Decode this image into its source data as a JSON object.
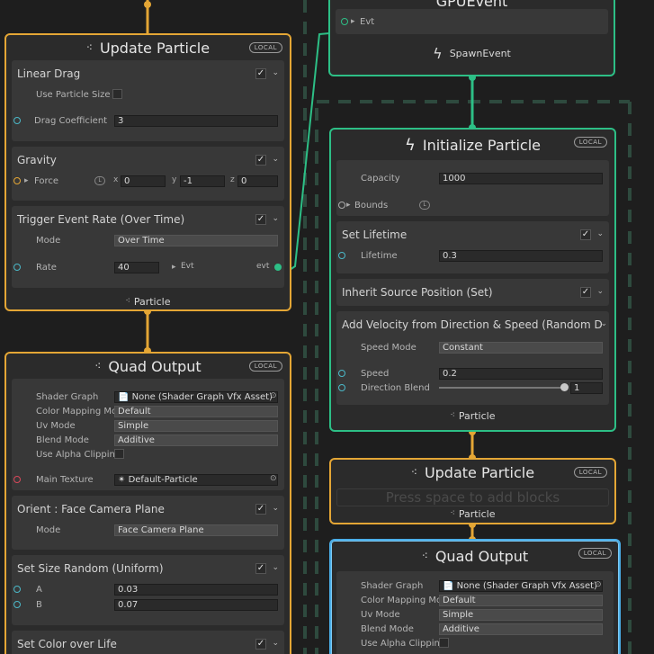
{
  "left": {
    "update": {
      "title": "Update Particle",
      "badge": "LOCAL",
      "linear_drag": {
        "title": "Linear Drag",
        "use_particle_size_label": "Use Particle Size",
        "drag_coefficient_label": "Drag Coefficient",
        "drag_coefficient_value": "3"
      },
      "gravity": {
        "title": "Gravity",
        "force_label": "Force",
        "x_label": "x",
        "x_value": "0",
        "y_label": "y",
        "y_value": "-1",
        "z_label": "z",
        "z_value": "0",
        "space_icon": "L"
      },
      "trigger": {
        "title": "Trigger Event Rate (Over Time)",
        "mode_label": "Mode",
        "mode_value": "Over Time",
        "rate_label": "Rate",
        "rate_value": "40",
        "evt_label": "Evt",
        "evt_out_label": "evt"
      },
      "footer": "Particle"
    },
    "quad": {
      "title": "Quad Output",
      "badge": "LOCAL",
      "shader_graph_label": "Shader Graph",
      "shader_graph_value": "None (Shader Graph Vfx Asset)",
      "color_mapping_label": "Color Mapping Mo",
      "color_mapping_value": "Default",
      "uv_mode_label": "Uv Mode",
      "uv_mode_value": "Simple",
      "blend_mode_label": "Blend Mode",
      "blend_mode_value": "Additive",
      "use_alpha_label": "Use Alpha Clippin",
      "main_texture_label": "Main Texture",
      "main_texture_value": "Default-Particle",
      "orient": {
        "title": "Orient : Face Camera Plane",
        "mode_label": "Mode",
        "mode_value": "Face Camera Plane"
      },
      "size": {
        "title": "Set Size Random (Uniform)",
        "a_label": "A",
        "a_value": "0.03",
        "b_label": "B",
        "b_value": "0.07"
      },
      "color_over_life": {
        "title": "Set Color over Life"
      }
    }
  },
  "right": {
    "gpu_event": {
      "title": "GPUEvent",
      "evt_label": "Evt",
      "footer": "SpawnEvent"
    },
    "init": {
      "title": "Initialize Particle",
      "badge": "LOCAL",
      "capacity_label": "Capacity",
      "capacity_value": "1000",
      "bounds_label": "Bounds",
      "bounds_icon": "L",
      "set_lifetime": {
        "title": "Set Lifetime",
        "lifetime_label": "Lifetime",
        "lifetime_value": "0.3"
      },
      "inherit": {
        "title": "Inherit Source Position (Set)"
      },
      "velocity": {
        "title": "Add Velocity from Direction & Speed (Random Direction)",
        "speed_mode_label": "Speed Mode",
        "speed_mode_value": "Constant",
        "speed_label": "Speed",
        "speed_value": "0.2",
        "direction_blend_label": "Direction Blend",
        "direction_blend_value": "1",
        "direction_blend_fraction": 1.0
      },
      "footer": "Particle"
    },
    "update": {
      "title": "Update Particle",
      "badge": "LOCAL",
      "placeholder": "Press space to add blocks",
      "footer": "Particle"
    },
    "quad": {
      "title": "Quad Output",
      "badge": "LOCAL",
      "shader_graph_label": "Shader Graph",
      "shader_graph_value": "None (Shader Graph Vfx Asset)",
      "color_mapping_label": "Color Mapping Mo",
      "color_mapping_value": "Default",
      "uv_mode_label": "Uv Mode",
      "uv_mode_value": "Simple",
      "blend_mode_label": "Blend Mode",
      "blend_mode_value": "Additive",
      "use_alpha_label": "Use Alpha Clippin"
    }
  },
  "colors": {
    "flow": "#e4a635",
    "event": "#2dbf86",
    "selected": "#4aaee8",
    "background": "#1e1e1e"
  },
  "icons": {
    "context_title": "particle-system-icon",
    "event": "lightning-bolt-icon",
    "checkbox": "check-icon",
    "collapse": "chevron-down-icon"
  }
}
